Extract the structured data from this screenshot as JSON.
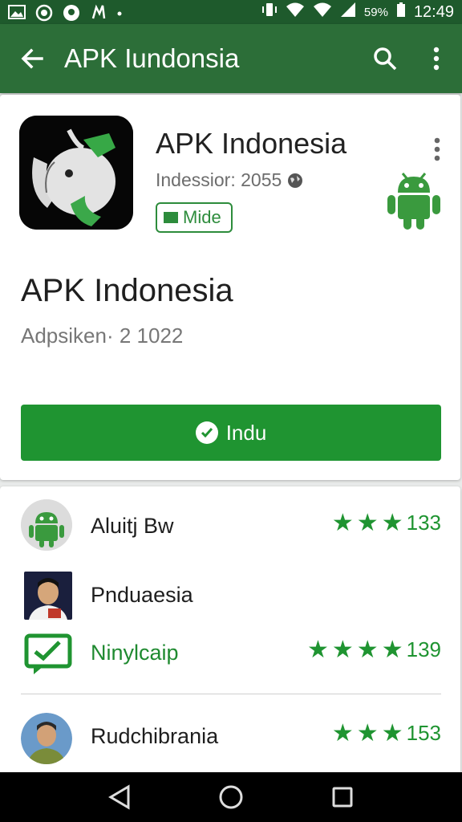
{
  "status_bar": {
    "battery_percent": "59%",
    "time": "12:49",
    "icons": [
      "image-icon",
      "whatsapp-icon",
      "circle-p-icon",
      "notification-icon",
      "dot-icon",
      "vibrate-icon",
      "wifi-icon",
      "wifi-icon",
      "signal-icon",
      "battery-icon"
    ]
  },
  "app_bar": {
    "title": "APK Iundonsia",
    "back_icon": "arrow-left-icon",
    "search_icon": "search-icon",
    "menu_icon": "more-vert-icon"
  },
  "app_header": {
    "name": "APK Indonesia",
    "subtitle": "Indessior: 2055",
    "badge_label": "Mide",
    "title_large": "APK Indonesia",
    "subtitle_large": "Adpsiken· 2 1022",
    "install_label": "Indu"
  },
  "related": [
    {
      "name": "Aluitj Bw",
      "stars": 3,
      "count": "133",
      "avatar": "android-avatar"
    },
    {
      "name": "Pnduaesia",
      "stars": 0,
      "count": "",
      "avatar": "person-avatar"
    },
    {
      "name": "Ninylcaip",
      "stars": 4,
      "count": "139",
      "avatar": "chat-check-icon"
    },
    {
      "name": "Rudchibrania",
      "stars": 3,
      "count": "153",
      "avatar": "person-avatar"
    }
  ],
  "colors": {
    "status_bar": "#1e5a2c",
    "app_bar": "#2c6e38",
    "accent_green": "#1f9431",
    "background": "#e9ebea"
  },
  "nav_bar": {
    "icons": [
      "back-triangle-icon",
      "home-circle-icon",
      "recents-square-icon"
    ]
  }
}
